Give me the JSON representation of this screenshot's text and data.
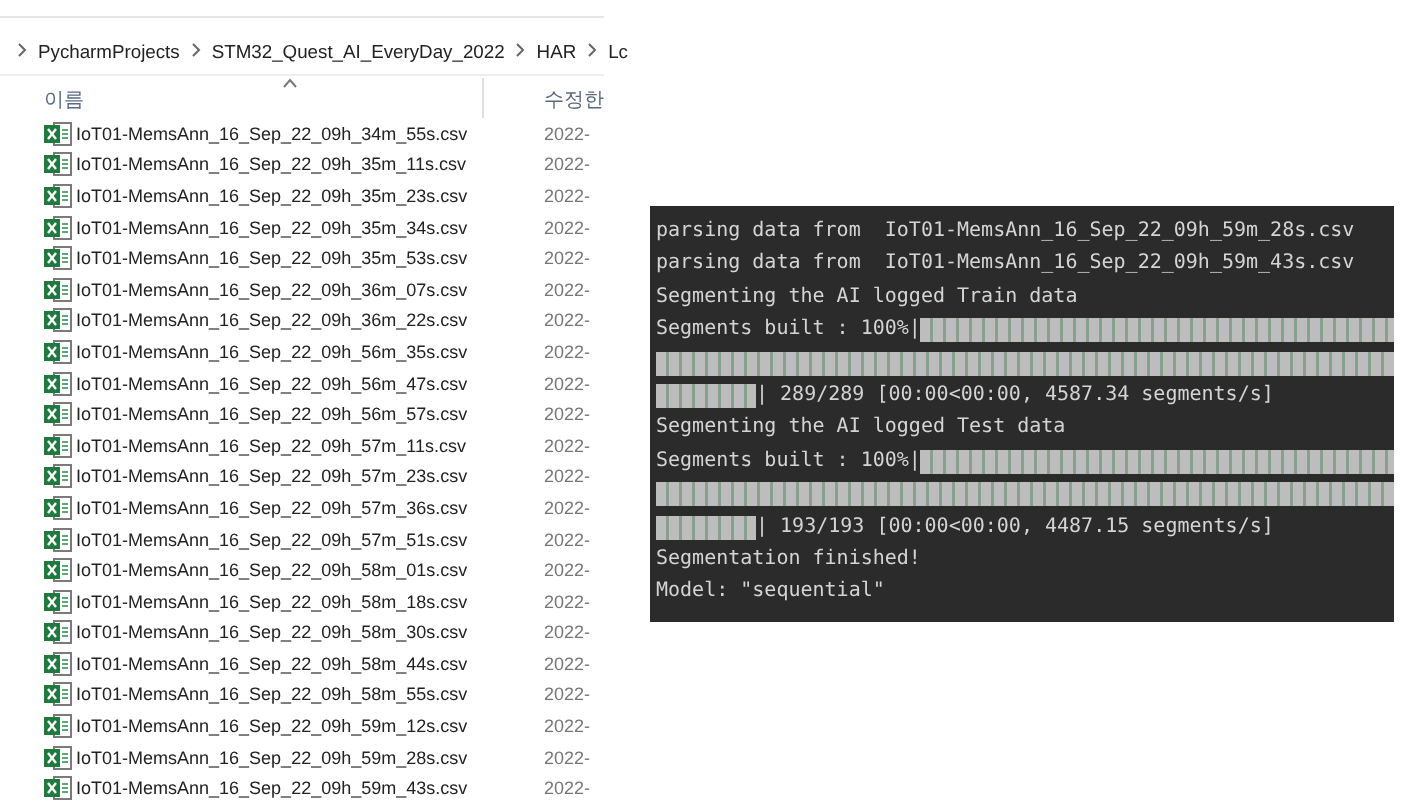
{
  "explorer": {
    "breadcrumb": [
      "PycharmProjects",
      "STM32_Quest_AI_EveryDay_2022",
      "HAR",
      "Lc"
    ],
    "columns": [
      {
        "label": "이름",
        "sorted": true
      },
      {
        "label": "수정한",
        "sorted": false
      }
    ],
    "files": [
      {
        "name": "IoT01-MemsAnn_16_Sep_22_09h_34m_55s.csv",
        "modified": "2022-"
      },
      {
        "name": "IoT01-MemsAnn_16_Sep_22_09h_35m_11s.csv",
        "modified": "2022-"
      },
      {
        "name": "IoT01-MemsAnn_16_Sep_22_09h_35m_23s.csv",
        "modified": "2022-"
      },
      {
        "name": "IoT01-MemsAnn_16_Sep_22_09h_35m_34s.csv",
        "modified": "2022-"
      },
      {
        "name": "IoT01-MemsAnn_16_Sep_22_09h_35m_53s.csv",
        "modified": "2022-"
      },
      {
        "name": "IoT01-MemsAnn_16_Sep_22_09h_36m_07s.csv",
        "modified": "2022-"
      },
      {
        "name": "IoT01-MemsAnn_16_Sep_22_09h_36m_22s.csv",
        "modified": "2022-"
      },
      {
        "name": "IoT01-MemsAnn_16_Sep_22_09h_56m_35s.csv",
        "modified": "2022-"
      },
      {
        "name": "IoT01-MemsAnn_16_Sep_22_09h_56m_47s.csv",
        "modified": "2022-"
      },
      {
        "name": "IoT01-MemsAnn_16_Sep_22_09h_56m_57s.csv",
        "modified": "2022-"
      },
      {
        "name": "IoT01-MemsAnn_16_Sep_22_09h_57m_11s.csv",
        "modified": "2022-"
      },
      {
        "name": "IoT01-MemsAnn_16_Sep_22_09h_57m_23s.csv",
        "modified": "2022-"
      },
      {
        "name": "IoT01-MemsAnn_16_Sep_22_09h_57m_36s.csv",
        "modified": "2022-"
      },
      {
        "name": "IoT01-MemsAnn_16_Sep_22_09h_57m_51s.csv",
        "modified": "2022-"
      },
      {
        "name": "IoT01-MemsAnn_16_Sep_22_09h_58m_01s.csv",
        "modified": "2022-"
      },
      {
        "name": "IoT01-MemsAnn_16_Sep_22_09h_58m_18s.csv",
        "modified": "2022-"
      },
      {
        "name": "IoT01-MemsAnn_16_Sep_22_09h_58m_30s.csv",
        "modified": "2022-"
      },
      {
        "name": "IoT01-MemsAnn_16_Sep_22_09h_58m_44s.csv",
        "modified": "2022-"
      },
      {
        "name": "IoT01-MemsAnn_16_Sep_22_09h_58m_55s.csv",
        "modified": "2022-"
      },
      {
        "name": "IoT01-MemsAnn_16_Sep_22_09h_59m_12s.csv",
        "modified": "2022-"
      },
      {
        "name": "IoT01-MemsAnn_16_Sep_22_09h_59m_28s.csv",
        "modified": "2022-"
      },
      {
        "name": "IoT01-MemsAnn_16_Sep_22_09h_59m_43s.csv",
        "modified": "2022-"
      }
    ]
  },
  "terminal": {
    "lines": [
      {
        "kind": "text",
        "text": "parsing data from  IoT01-MemsAnn_16_Sep_22_09h_59m_28s.csv"
      },
      {
        "kind": "text",
        "text": "parsing data from  IoT01-MemsAnn_16_Sep_22_09h_59m_43s.csv"
      },
      {
        "kind": "text",
        "text": "Segmenting the AI logged Train data"
      },
      {
        "kind": "progress",
        "prefix": "Segments built : 100%|",
        "level": 1,
        "suffix": "| 289/289 [00:00<00:00, 4587.34 segments/s]"
      },
      {
        "kind": "text",
        "text": "Segmenting the AI logged Test data"
      },
      {
        "kind": "progress",
        "prefix": "Segments built : 100%|",
        "level": 1,
        "suffix": "| 193/193 [00:00<00:00, 4487.15 segments/s]"
      },
      {
        "kind": "text",
        "text": "Segmentation finished!"
      },
      {
        "kind": "text",
        "text": "Model: \"sequential\""
      }
    ]
  }
}
